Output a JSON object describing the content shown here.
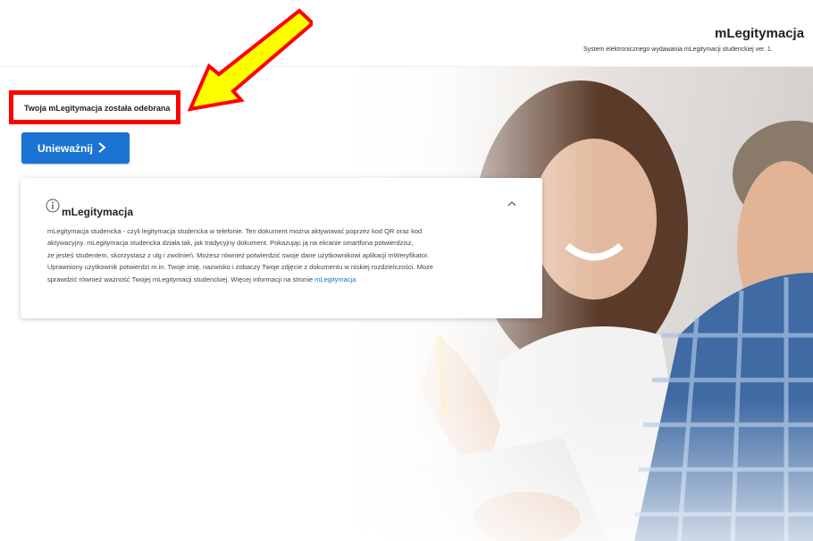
{
  "header": {
    "title": "mLegitymacja",
    "subtitle": "System elektronicznego wydawania mLegitymacji studenckiej ver. 1."
  },
  "notice": {
    "text": "Twoja mLegitymacja została odebrana"
  },
  "actions": {
    "revoke_label": "Unieważnij"
  },
  "info_card": {
    "title": "mLegitymacja",
    "lines": [
      "mLegitymacja studencka - czyli legitymacja studencka w telefonie. Ten dokument można aktywować poprzez kod QR oraz kod",
      "aktywacyjny. mLegitymacja studencka działa tak, jak tradycyjny dokument. Pokazując ją na ekranie smartfona potwierdzisz,",
      "że jesteś studentem, skorzystasz z ulg i zwolnień. Możesz również potwierdzić swoje dane użytkownikowi aplikacji mWeryfikator.",
      "Uprawniony użytkownik potwierdzi m.in. Twoje imię, nazwisko i zobaczy Twoje zdjęcie z dokumentu w niskiej rozdzielczości. Może",
      "sprawdzić również ważność Twojej mLegitymacji studenckiej. Więcej informacji na stronie"
    ],
    "link_text": "mLegitymacja"
  },
  "icons": {
    "info": "info-circle-icon",
    "collapse": "chevron-up-icon",
    "revoke": "chevron-right-icon",
    "annotation": "arrow-icon"
  },
  "colors": {
    "primary": "#1b73d3",
    "annotation_border": "#ff0000",
    "annotation_arrow": "#ffff00"
  }
}
